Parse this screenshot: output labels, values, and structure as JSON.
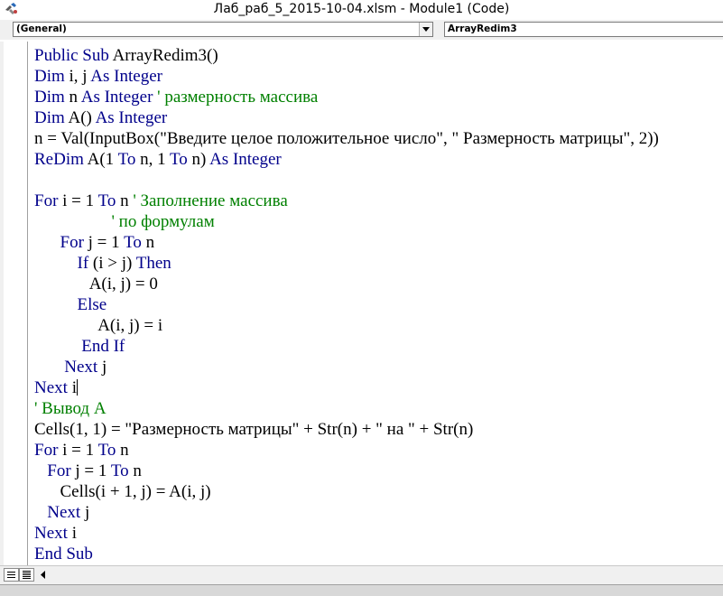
{
  "window": {
    "title": "Лаб_раб_5_2015-10-04.xlsm - Module1 (Code)"
  },
  "combos": {
    "object": "(General)",
    "procedure": "ArrayRedim3"
  },
  "code": {
    "lines": [
      [
        {
          "t": "Public Sub ",
          "c": "kw"
        },
        {
          "t": "ArrayRedim3()",
          "c": ""
        }
      ],
      [
        {
          "t": "Dim ",
          "c": "kw"
        },
        {
          "t": "i, j ",
          "c": ""
        },
        {
          "t": "As Integer",
          "c": "kw"
        }
      ],
      [
        {
          "t": "Dim ",
          "c": "kw"
        },
        {
          "t": "n ",
          "c": ""
        },
        {
          "t": "As Integer ",
          "c": "kw"
        },
        {
          "t": "' размерность массива",
          "c": "cm"
        }
      ],
      [
        {
          "t": "Dim ",
          "c": "kw"
        },
        {
          "t": "A() ",
          "c": ""
        },
        {
          "t": "As Integer",
          "c": "kw"
        }
      ],
      [
        {
          "t": "n = Val(InputBox(\"Введите целое положительное число\", \" Размерность матрицы\", 2))",
          "c": ""
        }
      ],
      [
        {
          "t": "ReDim ",
          "c": "kw"
        },
        {
          "t": "A(1 ",
          "c": ""
        },
        {
          "t": "To ",
          "c": "kw"
        },
        {
          "t": "n, 1 ",
          "c": ""
        },
        {
          "t": "To ",
          "c": "kw"
        },
        {
          "t": "n) ",
          "c": ""
        },
        {
          "t": "As Integer",
          "c": "kw"
        }
      ],
      [],
      [
        {
          "t": "For ",
          "c": "kw"
        },
        {
          "t": "i = 1 ",
          "c": ""
        },
        {
          "t": "To ",
          "c": "kw"
        },
        {
          "t": "n ",
          "c": ""
        },
        {
          "t": "' Заполнение массива",
          "c": "cm"
        }
      ],
      [
        {
          "t": "                  ' по формулам",
          "c": "cm"
        }
      ],
      [
        {
          "t": "      ",
          "c": ""
        },
        {
          "t": "For ",
          "c": "kw"
        },
        {
          "t": "j = 1 ",
          "c": ""
        },
        {
          "t": "To ",
          "c": "kw"
        },
        {
          "t": "n",
          "c": ""
        }
      ],
      [
        {
          "t": "          ",
          "c": ""
        },
        {
          "t": "If ",
          "c": "kw"
        },
        {
          "t": "(i > j) ",
          "c": ""
        },
        {
          "t": "Then",
          "c": "kw"
        }
      ],
      [
        {
          "t": "             A(i, j) = 0",
          "c": ""
        }
      ],
      [
        {
          "t": "          ",
          "c": ""
        },
        {
          "t": "Else",
          "c": "kw"
        }
      ],
      [
        {
          "t": "               A(i, j) = i",
          "c": ""
        }
      ],
      [
        {
          "t": "           ",
          "c": ""
        },
        {
          "t": "End If",
          "c": "kw"
        }
      ],
      [
        {
          "t": "       ",
          "c": ""
        },
        {
          "t": "Next ",
          "c": "kw"
        },
        {
          "t": "j",
          "c": ""
        }
      ],
      [
        {
          "t": "Next ",
          "c": "kw"
        },
        {
          "t": "i",
          "c": ""
        },
        {
          "t": "",
          "c": "caret"
        }
      ],
      [
        {
          "t": "' Вывод А",
          "c": "cm"
        }
      ],
      [
        {
          "t": "Cells(1, 1) = \"Размерность матрицы\" + Str(n) + \" на \" + Str(n)",
          "c": ""
        }
      ],
      [
        {
          "t": "For ",
          "c": "kw"
        },
        {
          "t": "i = 1 ",
          "c": ""
        },
        {
          "t": "To ",
          "c": "kw"
        },
        {
          "t": "n",
          "c": ""
        }
      ],
      [
        {
          "t": "   ",
          "c": ""
        },
        {
          "t": "For ",
          "c": "kw"
        },
        {
          "t": "j = 1 ",
          "c": ""
        },
        {
          "t": "To ",
          "c": "kw"
        },
        {
          "t": "n",
          "c": ""
        }
      ],
      [
        {
          "t": "      Cells(i + 1, j) = A(i, j)",
          "c": ""
        }
      ],
      [
        {
          "t": "   ",
          "c": ""
        },
        {
          "t": "Next ",
          "c": "kw"
        },
        {
          "t": "j",
          "c": ""
        }
      ],
      [
        {
          "t": "Next ",
          "c": "kw"
        },
        {
          "t": "i",
          "c": ""
        }
      ],
      [
        {
          "t": "End Sub",
          "c": "kw"
        }
      ]
    ]
  },
  "colors": {
    "keyword": "#00008b",
    "comment": "#008000",
    "text": "#000000"
  },
  "icons": {
    "app": "vba-editor-icon",
    "procedure_view": "procedure-view-icon",
    "full_module_view": "full-module-view-icon",
    "scroll_left": "scroll-left-arrow-icon",
    "dropdown": "chevron-down-icon"
  }
}
